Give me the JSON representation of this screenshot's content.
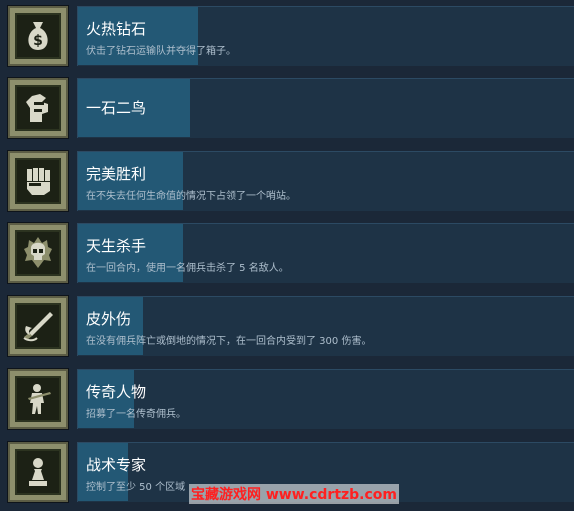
{
  "achievements": [
    {
      "title": "火热钻石",
      "description": "伏击了钻石运输队并夺得了箱子。",
      "icon": "money-bag-icon",
      "progress_fraction": 0.24
    },
    {
      "title": "一石二鸟",
      "description": "",
      "icon": "two-birds-icon",
      "progress_fraction": 0.22
    },
    {
      "title": "完美胜利",
      "description": "在不失去任何生命值的情况下占领了一个哨站。",
      "icon": "fist-icon",
      "progress_fraction": 0.21
    },
    {
      "title": "天生杀手",
      "description": "在一回合内，使用一名佣兵击杀了 5 名敌人。",
      "icon": "flaming-skull-icon",
      "progress_fraction": 0.21
    },
    {
      "title": "皮外伤",
      "description": "在没有佣兵阵亡或倒地的情况下，在一回合内受到了 300 伤害。",
      "icon": "bandage-icon",
      "progress_fraction": 0.13
    },
    {
      "title": "传奇人物",
      "description": "招募了一名传奇佣兵。",
      "icon": "soldier-icon",
      "progress_fraction": 0.12
    },
    {
      "title": "战术专家",
      "description": "控制了至少 50 个区域",
      "icon": "chess-pawn-icon",
      "progress_fraction": 0.1
    }
  ],
  "watermark": "宝藏游戏网 www.cdrtzb.com",
  "colors": {
    "background": "#1b2838",
    "panel": "#1e3346",
    "progress_bar": "#235875",
    "icon_frame": "#8d8f6c"
  }
}
